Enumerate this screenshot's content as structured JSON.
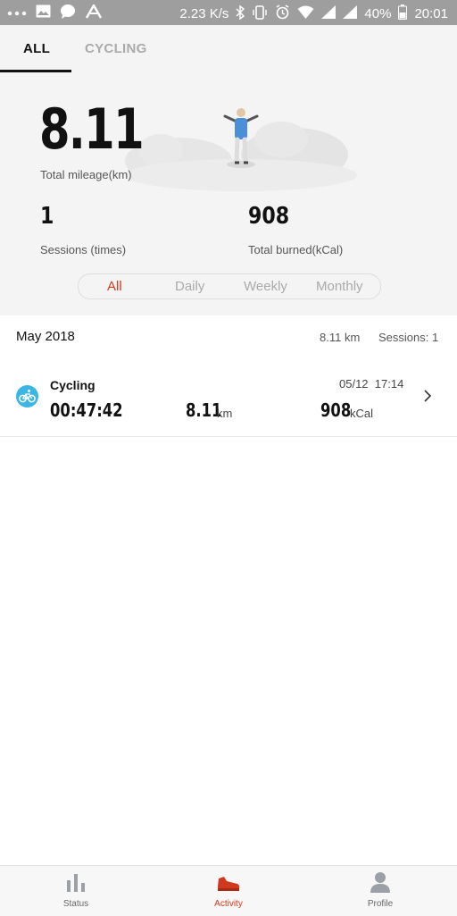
{
  "status_bar": {
    "speed": "2.23 K/s",
    "battery": "40%",
    "time": "20:01"
  },
  "tabs": {
    "all": "ALL",
    "cycling": "CYCLING"
  },
  "summary": {
    "total_mileage_value": "8.11",
    "total_mileage_label": "Total mileage(km)",
    "sessions_value": "1",
    "sessions_label": "Sessions (times)",
    "burned_value": "908",
    "burned_label": "Total burned(kCal)"
  },
  "period_filter": {
    "options": [
      "All",
      "Daily",
      "Weekly",
      "Monthly"
    ],
    "selected": "All"
  },
  "month": {
    "title": "May 2018",
    "km": "8.11 km",
    "sessions": "Sessions: 1"
  },
  "activity": {
    "name": "Cycling",
    "date": "05/12",
    "time": "17:14",
    "duration": "00:47:42",
    "distance": "8.11",
    "distance_unit": "km",
    "calories": "908",
    "calories_unit": "kCal"
  },
  "bottom_nav": {
    "status": "Status",
    "activity": "Activity",
    "profile": "Profile"
  },
  "colors": {
    "accent": "#d0391d",
    "cycling_icon": "#3bb5e3",
    "status_bar": "#9e9e9e"
  }
}
